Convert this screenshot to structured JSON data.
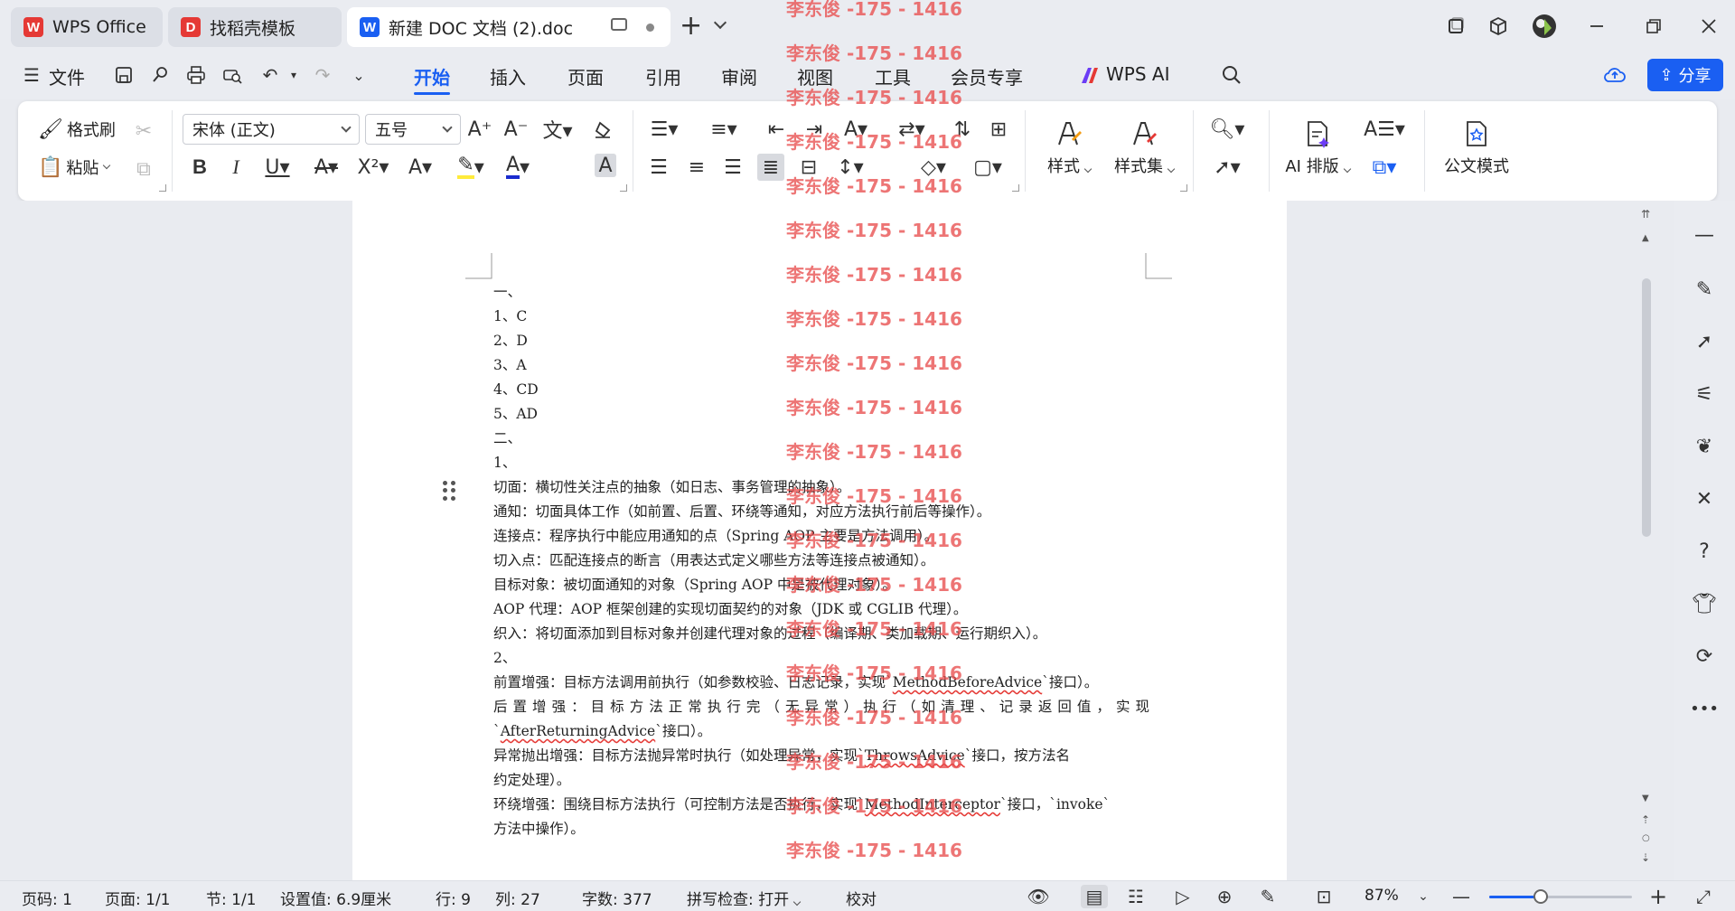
{
  "tabs": [
    {
      "label": "WPS Office",
      "logo": "W",
      "logo_color": "#e53935"
    },
    {
      "label": "找稻壳模板",
      "logo": "D",
      "logo_color": "#e53935"
    },
    {
      "label": "新建 DOC 文档 (2).doc",
      "logo": "W",
      "logo_color": "#1a5ff2"
    }
  ],
  "menu": {
    "file": "文件",
    "tabs": [
      "开始",
      "插入",
      "页面",
      "引用",
      "审阅",
      "视图",
      "工具",
      "会员专享"
    ],
    "active_tab": "开始",
    "wps_ai": "WPS AI",
    "share": "分享"
  },
  "ribbon": {
    "format_painter": "格式刷",
    "paste": "粘贴",
    "font_name": "宋体 (正文)",
    "font_size": "五号",
    "styles": "样式",
    "style_set": "样式集",
    "ai_layout": "AI 排版",
    "official_mode": "公文模式",
    "accent": "#1a5ff2"
  },
  "document": {
    "lines": [
      {
        "text": "一、"
      },
      {
        "text": "1、C"
      },
      {
        "text": "2、D"
      },
      {
        "text": "3、A"
      },
      {
        "text": "4、CD"
      },
      {
        "text": "5、AD"
      },
      {
        "text": "二、"
      },
      {
        "text": "1、"
      },
      {
        "text": "切面：横切性关注点的抽象（如日志、事务管理的抽象）。"
      },
      {
        "text": "通知：切面具体工作（如前置、后置、环绕等通知，对应方法执行前后等操作）。"
      },
      {
        "text": "连接点：程序执行中能应用通知的点（Spring AOP 主要是方法调用）。"
      },
      {
        "text": "切入点：匹配连接点的断言（用表达式定义哪些方法等连接点被通知）。"
      },
      {
        "text": "目标对象：被切面通知的对象（Spring AOP 中是被代理对象）。"
      },
      {
        "text": "AOP 代理：AOP 框架创建的实现切面契约的对象（JDK 或 CGLIB 代理）。"
      },
      {
        "text": "织入：将切面添加到目标对象并创建代理对象的过程（编译期、类加载期、运行期织入）。"
      },
      {
        "text": "2、"
      },
      {
        "pre": "前置增强：目标方法调用前执行（如参数校验、日志记录，实现`",
        "link": "MethodBeforeAdvice",
        "post": "`接口）。"
      },
      {
        "text": "后置增强：目标方法正常执行完（无异常）执行（如清理、记录返回值，实现",
        "justify": true
      },
      {
        "pre": "`",
        "link": "AfterReturningAdvice",
        "post": "`接口）。"
      },
      {
        "pre": " 异常抛出增强：目标方法抛异常时执行（如处理异常，实现`",
        "link": "ThrowsAdvice",
        "post": "`接口，按方法名"
      },
      {
        "text": "约定处理）。"
      },
      {
        "pre": "环绕增强：围绕目标方法执行（可控制方法是否执行，实现`",
        "link": "MethodInterceptor",
        "post": "`接口，`invoke`"
      },
      {
        "text": "方法中操作）。"
      }
    ]
  },
  "watermark": "李东俊 -175 - 1416",
  "status": {
    "page_num": "页码: 1",
    "pages": "页面: 1/1",
    "section": "节: 1/1",
    "setting": "设置值: 6.9厘米",
    "row": "行: 9",
    "col": "列: 27",
    "word_count": "字数: 377",
    "spell_check": "拼写检查: 打开",
    "proofread": "校对",
    "zoom": "87%",
    "zoom_fraction": 0.36
  }
}
